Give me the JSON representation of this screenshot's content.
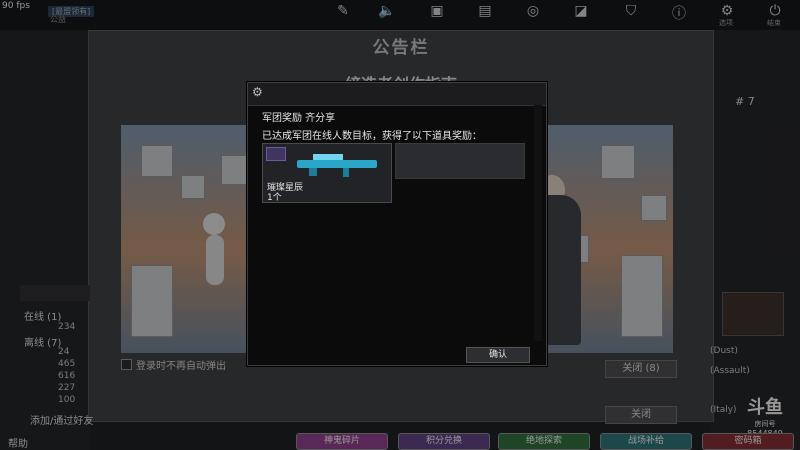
{
  "fps": "90 fps",
  "header": {
    "tag": "[最盟领有]",
    "sub": "公益",
    "settings_label": "选项",
    "exit_label": "结束",
    "icons": [
      "edit-icon",
      "speaker-icon",
      "tv-icon",
      "bag-icon",
      "gamepad-icon",
      "ticket-icon",
      "shield-icon",
      "alert-icon",
      "gear-icon",
      "power-icon"
    ]
  },
  "board": {
    "title": "公告栏",
    "heading": "缔造者创作指南",
    "dont_show_label": "登录时不再自动弹出",
    "close_label": "关闭 (8)",
    "close2_label": "关闭"
  },
  "sidebar": {
    "online_label": "在线 (1)",
    "online_count": "234",
    "offline_label": "离线 (7)",
    "stats": [
      "24",
      "465",
      "616",
      "227",
      "100"
    ],
    "add_friend": "添加/通过好友",
    "help": "帮助"
  },
  "right": {
    "rank": "# 7",
    "lines": [
      "(Dust)",
      "(Assault)",
      "(Italy)"
    ],
    "douyu_room": "房间号",
    "douyu_id": "8544849",
    "douyu_logo": "斗鱼"
  },
  "bottom_buttons": [
    {
      "label": "神鬼碎片",
      "color": "#8a3e86"
    },
    {
      "label": "积分兑换",
      "color": "#5b3f7d"
    },
    {
      "label": "绝地探索",
      "color": "#2f6a3a"
    },
    {
      "label": "战场补给",
      "color": "#2b6f74"
    },
    {
      "label": "密码箱",
      "color": "#7e2d33"
    }
  ],
  "dialog": {
    "title": "军团奖励  齐分享",
    "message": "已达成军团在线人数目标，获得了以下道具奖励：",
    "item_name": "璀璨星辰",
    "item_qty": "1个",
    "confirm_label": "确认"
  }
}
